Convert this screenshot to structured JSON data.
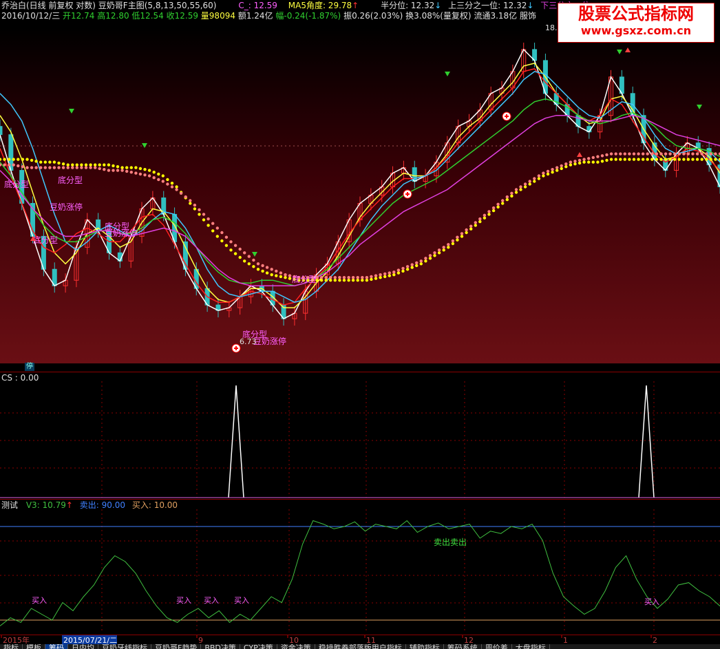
{
  "header": {
    "line1_left": "乔治白(日线 前复权 对数) 豆奶哥F主图(5,8,13,50,55,60)",
    "c_label": "C_: 12.59",
    "ma5_label": "MA5角度: 29.78",
    "half_label": "半分位: 12.32",
    "upper_third_label": "上三分之一位: 12.32",
    "lower_third_label": "下三分之一位",
    "line2_date": "2016/10/12/三",
    "open": "开12.74",
    "high": "高12.80",
    "low": "低12.54",
    "close": "收12.59",
    "volume": "量98094",
    "amount": "额1.24亿",
    "change": "幅-0.24(-1.87%)",
    "amplitude": "振0.26(2.03%)",
    "turnover": "换3.08%(量复权)",
    "float_cap": "流通3.18亿",
    "industry": "服饰"
  },
  "watermark": {
    "line1": "股票公式指标网",
    "line2": "www.gsxz.com.cn"
  },
  "main_chart": {
    "max_label": "18.",
    "min_label": "6.73",
    "stop_label": "停",
    "annotations": [
      "底分型",
      "底分型",
      "豆奶涨停",
      "底分型",
      "底分型",
      "豆奶涨停",
      "底分型",
      "底分型",
      "豆奶涨停"
    ]
  },
  "cs_panel": {
    "title": "CS : 0.00"
  },
  "test_panel": {
    "title": "测试",
    "v3_label": "V3: 10.79",
    "sell_label": "卖出: 90.00",
    "buy_label": "买入: 10.00",
    "buy_marker": "买入",
    "sell_marker": "卖出卖出"
  },
  "time_axis": {
    "labels": [
      "2015年",
      "9",
      "10",
      "11",
      "12",
      "1",
      "2"
    ],
    "selected_date": "2015/07/21/二"
  },
  "tabs": [
    "指标",
    "模板",
    "筹码",
    "日内均",
    "豆奶牙线指标",
    "豆奶哥F趋势",
    "BBD决策",
    "CYP决策",
    "资金决策",
    "稳操胜券部落版用户指标",
    "辅助指标",
    "筹码系统",
    "周价差",
    "大盘指标"
  ],
  "colors": {
    "up": "#ff3030",
    "down": "#30c0c0",
    "ma_white": "#ffffff",
    "ma_yellow": "#ffff40",
    "ma_red": "#ff2020",
    "ma_cyan": "#40c8ff",
    "ma_green": "#30d030",
    "ma_magenta": "#e040e0",
    "dot_yellow": "#ffff00",
    "dot_pink": "#ff8080",
    "v3": "#40c040",
    "sell_line": "#4080ff",
    "buy_line": "#e0a060"
  },
  "chart_data": {
    "type": "line",
    "main": {
      "series": [
        {
          "values": [
            14.5,
            13.2,
            12.0,
            10.8,
            9.6,
            9.0,
            9.2,
            10.4,
            11.4,
            11.0,
            10.2,
            9.9,
            10.8,
            11.8,
            12.2,
            11.6,
            10.6,
            9.6,
            8.9,
            8.3,
            8.1,
            8.2,
            8.6,
            9.0,
            8.8,
            8.3,
            7.8,
            8.0,
            8.8,
            9.4,
            9.8,
            10.6,
            11.4,
            12.0,
            12.3,
            12.6,
            13.1,
            13.3,
            12.8,
            13.0,
            13.5,
            14.2,
            14.8,
            15.0,
            15.4,
            16.0,
            16.2,
            16.8,
            17.6,
            17.2,
            16.0,
            15.6,
            15.2,
            14.8,
            14.6,
            15.2,
            16.6,
            16.0,
            15.2,
            14.2,
            13.6,
            13.2,
            13.8,
            14.2,
            14.0,
            13.4,
            12.6
          ]
        },
        {
          "values": [
            15.2,
            14.6,
            13.6,
            12.4,
            11.2,
            10.2,
            9.8,
            10.2,
            10.9,
            11.1,
            10.8,
            10.4,
            10.6,
            11.3,
            11.8,
            11.7,
            11.2,
            10.4,
            9.6,
            8.9,
            8.5,
            8.4,
            8.6,
            8.9,
            8.9,
            8.6,
            8.2,
            8.2,
            8.6,
            9.1,
            9.5,
            10.1,
            10.8,
            11.5,
            12.0,
            12.4,
            12.8,
            13.1,
            13.0,
            13.0,
            13.3,
            13.8,
            14.4,
            14.8,
            15.1,
            15.6,
            16.0,
            16.4,
            17.0,
            17.1,
            16.6,
            16.0,
            15.6,
            15.2,
            14.9,
            15.0,
            15.8,
            15.9,
            15.4,
            14.7,
            14.1,
            13.6,
            13.7,
            14.0,
            14.0,
            13.7,
            13.1
          ]
        },
        {
          "values": [
            14.0,
            13.0,
            12.0,
            11.0,
            10.4,
            10.2,
            10.5,
            10.9,
            11.1,
            10.9,
            10.6,
            10.6,
            11.0,
            11.5,
            11.6,
            11.2,
            10.5,
            9.8,
            9.1,
            8.6,
            8.4,
            8.4,
            8.6,
            8.8,
            8.7,
            8.5,
            8.3,
            8.4,
            8.9,
            9.3,
            9.7,
            10.3,
            10.9,
            11.4,
            11.8,
            12.2,
            12.6,
            12.9,
            12.9,
            13.0,
            13.3,
            13.7,
            14.2,
            14.6,
            15.0,
            15.4,
            15.8,
            16.2,
            16.8,
            16.9,
            16.4,
            16.0,
            15.6,
            15.2,
            15.0,
            15.2,
            15.8,
            15.6,
            15.0,
            14.4,
            13.8,
            13.5,
            13.7,
            14.0,
            13.9,
            13.6,
            13.2
          ]
        },
        {
          "values": [
            16.0,
            15.6,
            15.0,
            14.0,
            12.8,
            11.6,
            10.6,
            10.3,
            10.6,
            11.0,
            11.2,
            11.0,
            10.8,
            11.0,
            11.4,
            11.7,
            11.6,
            11.1,
            10.4,
            9.6,
            9.0,
            8.7,
            8.6,
            8.7,
            8.8,
            8.8,
            8.6,
            8.4,
            8.5,
            8.8,
            9.2,
            9.6,
            10.2,
            10.8,
            11.4,
            11.9,
            12.3,
            12.7,
            12.9,
            13.0,
            13.2,
            13.6,
            14.0,
            14.4,
            14.8,
            15.2,
            15.6,
            16.0,
            16.5,
            16.8,
            16.7,
            16.3,
            15.9,
            15.5,
            15.2,
            15.1,
            15.4,
            15.7,
            15.6,
            15.1,
            14.5,
            14.0,
            13.8,
            13.9,
            14.0,
            13.9,
            13.5
          ]
        },
        {
          "values": [
            13.5,
            13.0,
            12.4,
            11.8,
            11.2,
            10.8,
            10.6,
            10.6,
            10.8,
            11.0,
            11.0,
            10.9,
            10.9,
            11.1,
            11.4,
            11.5,
            11.3,
            10.9,
            10.4,
            9.9,
            9.5,
            9.2,
            9.1,
            9.1,
            9.2,
            9.2,
            9.1,
            9.0,
            9.1,
            9.3,
            9.6,
            10.0,
            10.4,
            10.8,
            11.2,
            11.6,
            12.0,
            12.3,
            12.5,
            12.7,
            12.9,
            13.2,
            13.5,
            13.8,
            14.1,
            14.4,
            14.7,
            15.0,
            15.4,
            15.7,
            15.8,
            15.7,
            15.5,
            15.2,
            15.0,
            14.9,
            15.0,
            15.2,
            15.3,
            15.1,
            14.8,
            14.4,
            14.1,
            14.0,
            14.0,
            13.9,
            13.7
          ]
        },
        {
          "values": [
            13.2,
            12.8,
            12.3,
            11.8,
            11.4,
            11.0,
            10.8,
            10.8,
            10.9,
            11.0,
            11.0,
            10.9,
            10.8,
            10.9,
            11.0,
            11.1,
            11.0,
            10.8,
            10.4,
            10.0,
            9.6,
            9.3,
            9.1,
            9.0,
            9.0,
            9.0,
            9.0,
            9.0,
            9.1,
            9.3,
            9.5,
            9.8,
            10.1,
            10.5,
            10.8,
            11.1,
            11.4,
            11.7,
            11.9,
            12.1,
            12.3,
            12.5,
            12.8,
            13.1,
            13.4,
            13.7,
            14.0,
            14.3,
            14.6,
            14.9,
            15.1,
            15.2,
            15.2,
            15.1,
            15.0,
            15.0,
            15.0,
            15.1,
            15.2,
            15.1,
            14.9,
            14.7,
            14.5,
            14.4,
            14.3,
            14.2,
            14.1
          ]
        },
        {
          "values": [
            13.6,
            13.6,
            13.6,
            13.5,
            13.5,
            13.4,
            13.4,
            13.4,
            13.4,
            13.3,
            13.3,
            13.2,
            13.0,
            12.6,
            12.0,
            11.4,
            10.8,
            10.3,
            9.9,
            9.6,
            9.4,
            9.3,
            9.2,
            9.2,
            9.2,
            9.2,
            9.2,
            9.2,
            9.3,
            9.4,
            9.6,
            9.8,
            10.1,
            10.4,
            10.8,
            11.2,
            11.6,
            12.0,
            12.4,
            12.7,
            13.0,
            13.2,
            13.4,
            13.5,
            13.5,
            13.6,
            13.6,
            13.6,
            13.6,
            13.6,
            13.6,
            13.6,
            13.6,
            13.6
          ]
        },
        {
          "values": [
            13.4,
            13.4,
            13.3,
            13.3,
            13.3,
            13.3,
            13.3,
            13.3,
            13.2,
            13.2,
            13.1,
            13.0,
            12.8,
            12.5,
            12.1,
            11.6,
            11.1,
            10.6,
            10.2,
            9.8,
            9.6,
            9.4,
            9.3,
            9.3,
            9.3,
            9.3,
            9.3,
            9.3,
            9.4,
            9.5,
            9.7,
            9.9,
            10.2,
            10.5,
            10.9,
            11.3,
            11.7,
            12.1,
            12.5,
            12.8,
            13.1,
            13.3,
            13.5,
            13.6,
            13.7,
            13.8,
            13.8,
            13.8,
            13.8,
            13.8,
            13.8,
            13.8,
            13.8,
            13.8
          ]
        }
      ]
    },
    "cs": {
      "x": [
        0,
        1,
        2,
        3,
        4
      ],
      "values": [
        0,
        0,
        100,
        0,
        0
      ],
      "ylim": [
        0,
        100
      ]
    },
    "test": {
      "values": [
        5,
        12,
        8,
        20,
        15,
        10,
        25,
        18,
        30,
        40,
        55,
        65,
        60,
        50,
        35,
        22,
        12,
        8,
        15,
        20,
        12,
        18,
        8,
        15,
        10,
        20,
        30,
        25,
        45,
        75,
        95,
        92,
        88,
        90,
        94,
        86,
        92,
        90,
        88,
        95,
        85,
        90,
        93,
        88,
        90,
        92,
        80,
        86,
        84,
        90,
        88,
        92,
        78,
        50,
        30,
        22,
        15,
        20,
        35,
        55,
        65,
        45,
        30,
        20,
        28,
        40,
        42,
        35,
        30,
        22
      ],
      "sell": 90,
      "buy": 10,
      "ylim": [
        0,
        100
      ]
    }
  }
}
